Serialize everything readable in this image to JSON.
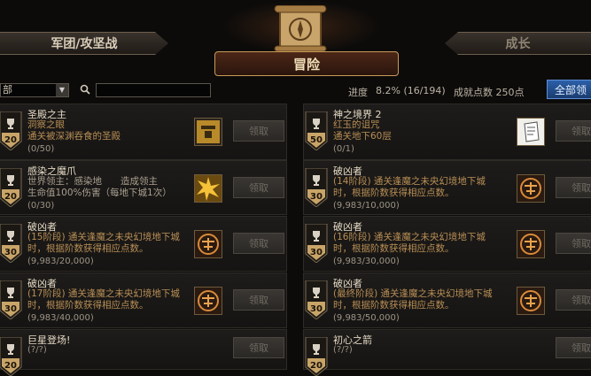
{
  "tabs": {
    "left": "军团/攻坚战",
    "center": "冒险",
    "right": "成长"
  },
  "filter": {
    "selected": "部",
    "search_value": ""
  },
  "progress": {
    "label": "进度",
    "value": "8.2% (16/194)",
    "points": "成就点数 250点",
    "fraction": 0.082
  },
  "receive_all": "全部领",
  "claim_label": "领取",
  "cards": [
    {
      "points": "20",
      "title": "圣殿之主",
      "desc": "洞察之眼\n通关被深渊吞食的圣殿",
      "progress": "(0/50)",
      "reward": "map-piece-icon",
      "descColor": "orange"
    },
    {
      "points": "50",
      "title": "神之境界 2",
      "desc": "红玉的诅咒\n通关地下60层",
      "progress": "(0/1)",
      "reward": "document-icon",
      "descColor": "orange"
    },
    {
      "points": "20",
      "title": "感染之魔爪",
      "desc": "世界领主：感染地　　造成领主\n生命值100%伤害（每地下城1次）",
      "progress": "(0/30)",
      "reward": "starburst-icon",
      "descColor": "grey"
    },
    {
      "points": "30",
      "title": "破凶者",
      "desc": "(14阶段) 通关逢魔之未央幻境地下城时，根据阶数获得相应点数。",
      "progress": "(9,983/10,000)",
      "reward": "emblem-icon",
      "descColor": "orange"
    },
    {
      "points": "30",
      "title": "破凶者",
      "desc": "(15阶段) 通关逢魔之未央幻境地下城时，根据阶数获得相应点数。",
      "progress": "(9,983/20,000)",
      "reward": "emblem-icon",
      "descColor": "orange"
    },
    {
      "points": "30",
      "title": "破凶者",
      "desc": "(16阶段) 通关逢魔之未央幻境地下城时，根据阶数获得相应点数。",
      "progress": "(9,983/30,000)",
      "reward": "emblem-icon",
      "descColor": "orange"
    },
    {
      "points": "30",
      "title": "破凶者",
      "desc": "(17阶段) 通关逢魔之未央幻境地下城时，根据阶数获得相应点数。",
      "progress": "(9,983/40,000)",
      "reward": "emblem-icon",
      "descColor": "orange"
    },
    {
      "points": "30",
      "title": "破凶者",
      "desc": "(最终阶段) 通关逢魔之未央幻境地下城时，根据阶数获得相应点数。",
      "progress": "(9,983/50,000)",
      "reward": "emblem-icon",
      "descColor": "orange"
    },
    {
      "points": "20",
      "title": "巨星登场!",
      "desc": "",
      "progress": "(?/?)",
      "reward": "",
      "descColor": "orange"
    },
    {
      "points": "20",
      "title": "初心之箭",
      "desc": "",
      "progress": "(?/?)",
      "reward": "",
      "descColor": "orange"
    }
  ]
}
